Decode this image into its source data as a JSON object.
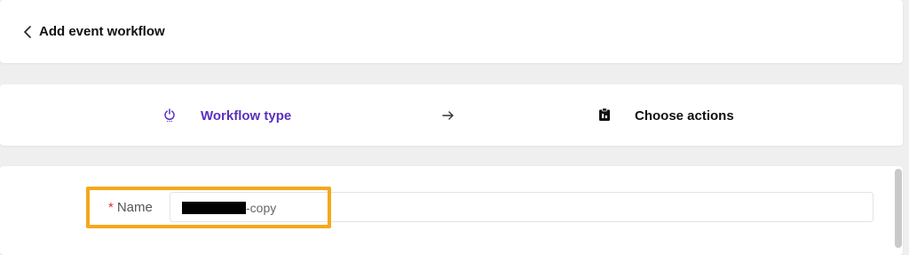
{
  "header": {
    "back_icon": "chevron-left-icon",
    "title": "Add event workflow"
  },
  "steps": {
    "items": [
      {
        "label": "Workflow type",
        "icon": "power-icon",
        "active": true,
        "color": "#5b2fc0"
      },
      {
        "label": "Choose actions",
        "icon": "clipboard-icon",
        "active": false,
        "color": "#111111"
      }
    ],
    "separator_icon": "arrow-right-icon"
  },
  "form": {
    "name_label": "Name",
    "required_marker": "*",
    "name_value_suffix": "-copy",
    "name_value_redacted": true
  },
  "colors": {
    "accent": "#5b2fc0",
    "required": "#e03131",
    "highlight": "#f5a81c"
  }
}
